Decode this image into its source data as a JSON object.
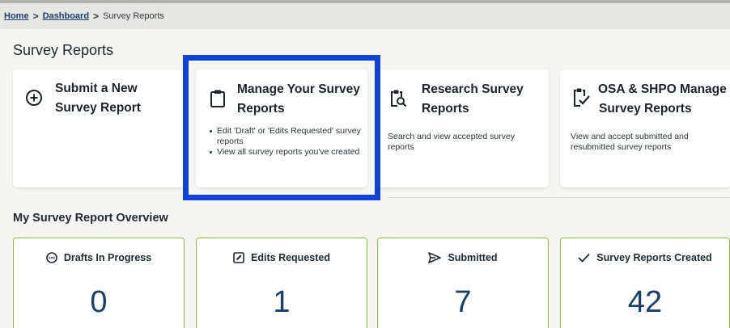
{
  "breadcrumb": {
    "home": "Home",
    "dashboard": "Dashboard",
    "current": "Survey Reports",
    "separator": ">"
  },
  "page_title": "Survey Reports",
  "cards": {
    "submit": {
      "title_line1": "Submit a New",
      "title_line2": "Survey Report",
      "icon": "plus-circle-icon"
    },
    "manage": {
      "title_line1": "Manage Your Survey",
      "title_line2": "Reports",
      "icon": "clipboard-icon",
      "bullets": [
        "Edit 'Draft' or 'Edits Requested' survey reports",
        "View all survey reports you've created"
      ]
    },
    "research": {
      "title_line1": "Research Survey",
      "title_line2": "Reports",
      "icon": "clipboard-search-icon",
      "description": "Search and view accepted survey reports"
    },
    "osa": {
      "title_line1": "OSA & SHPO Manage",
      "title_line2": "Survey Reports",
      "icon": "clipboard-check-icon",
      "description": "View and accept submitted and resubmitted survey reports"
    }
  },
  "overview": {
    "title": "My Survey Report Overview",
    "stats": [
      {
        "label": "Drafts In Progress",
        "value": "0",
        "icon": "dots-circle-icon"
      },
      {
        "label": "Edits Requested",
        "value": "1",
        "icon": "edit-square-icon"
      },
      {
        "label": "Submitted",
        "value": "7",
        "icon": "send-icon"
      },
      {
        "label": "Survey Reports Created",
        "value": "42",
        "icon": "check-icon"
      }
    ]
  },
  "colors": {
    "highlight": "#1042d8",
    "stat_border": "#8fbf3f",
    "stat_number": "#173f6b",
    "breadcrumb_link": "#173f6b"
  }
}
